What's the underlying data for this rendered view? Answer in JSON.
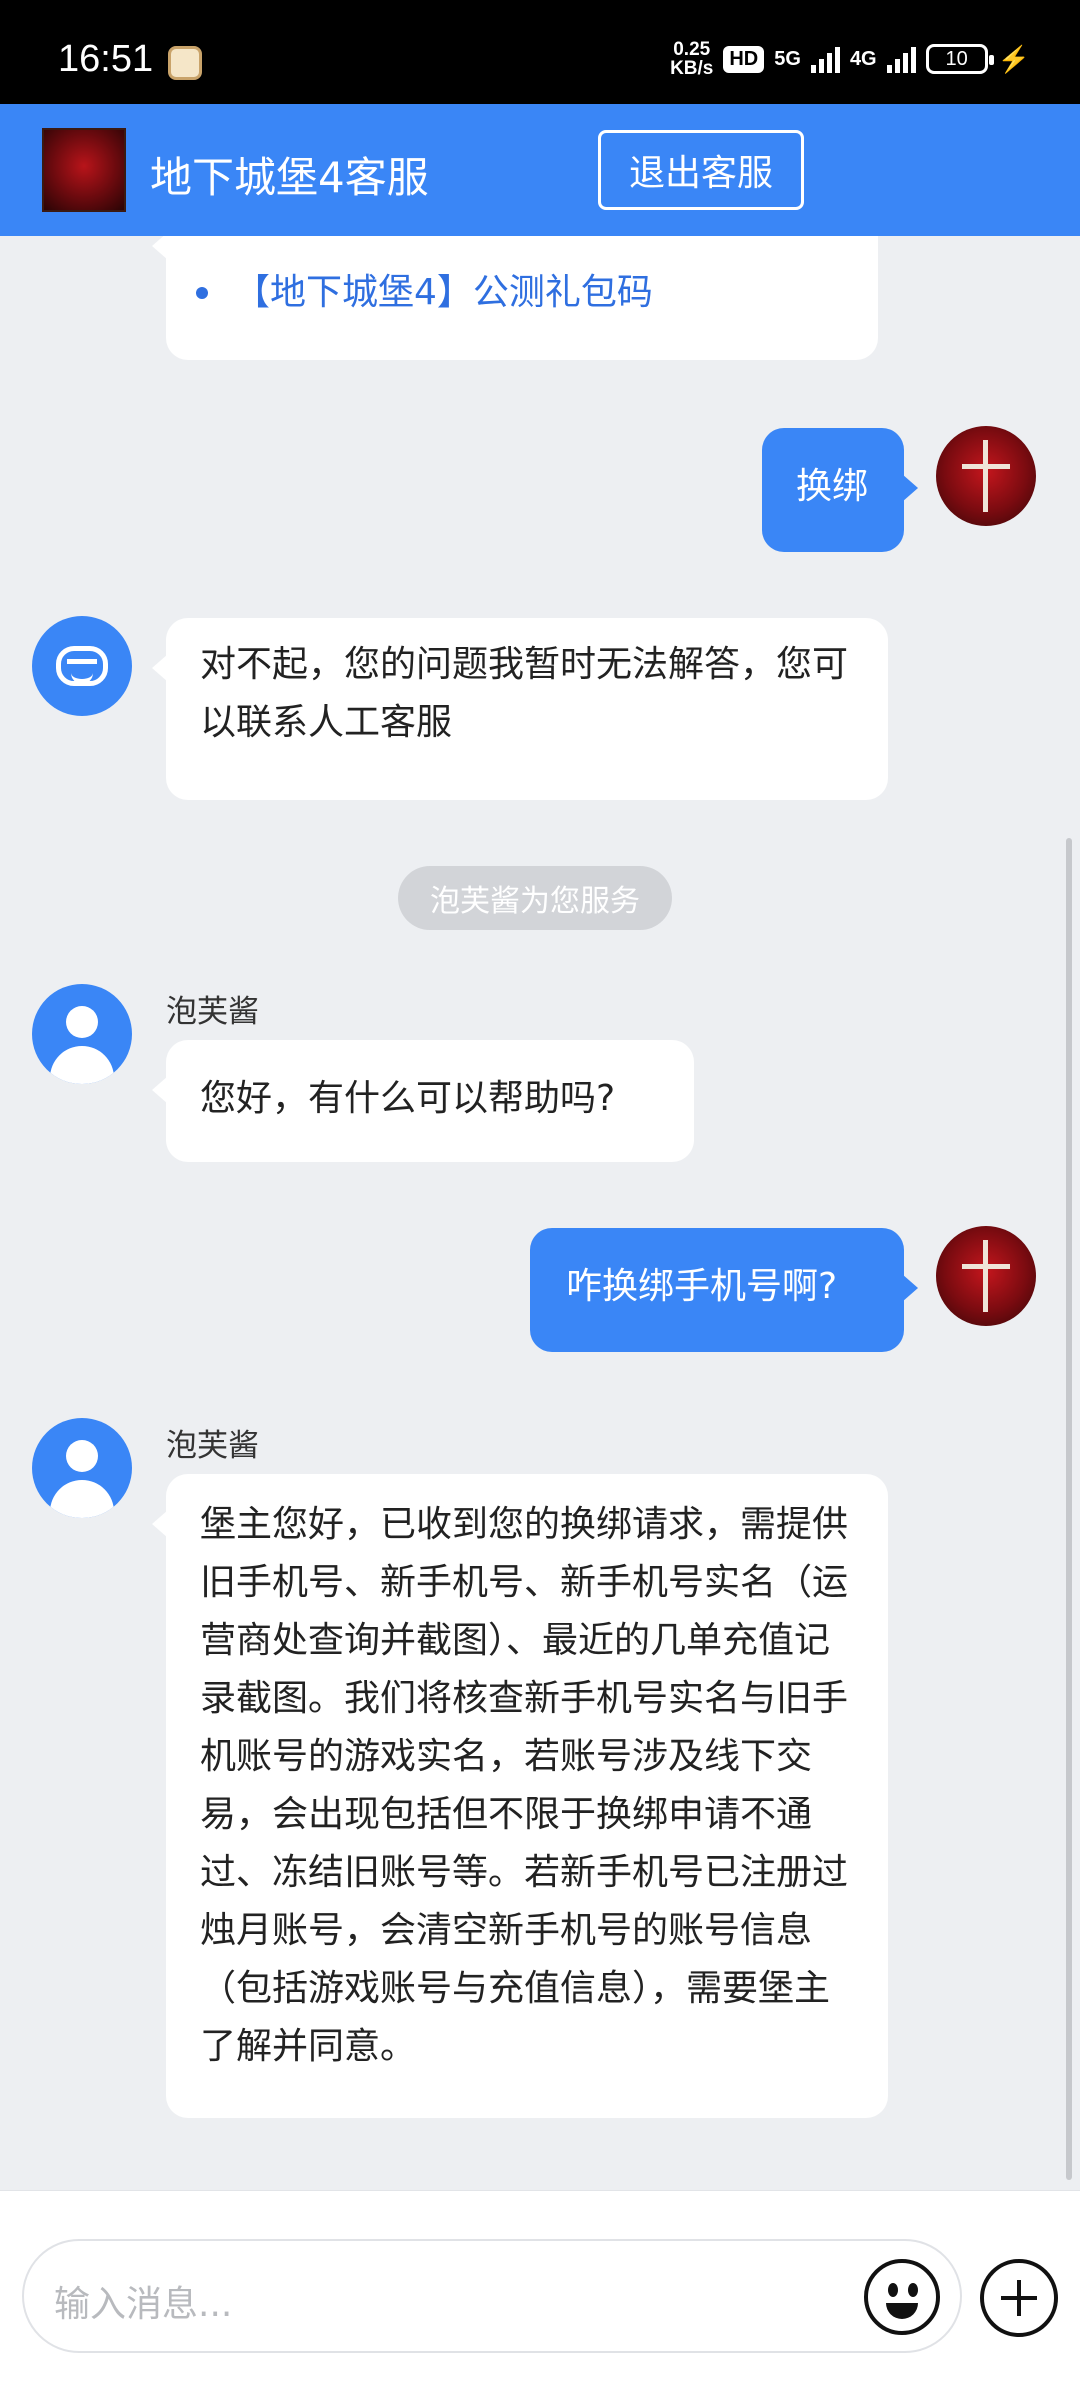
{
  "status_bar": {
    "time": "16:51",
    "speed_value": "0.25",
    "speed_unit": "KB/s",
    "hd": "HD",
    "net_5g": "5G",
    "net_4g": "4G",
    "battery": "10"
  },
  "header": {
    "title": "地下城堡4客服",
    "exit_label": "退出客服"
  },
  "chat": {
    "link_item": "【地下城堡4】公测礼包码",
    "msg_user_1": "换绑",
    "msg_bot_1": "对不起，您的问题我暂时无法解答，您可以联系人工客服",
    "system_notice": "泡芙酱为您服务",
    "agent_name": "泡芙酱",
    "msg_agent_1": "您好，有什么可以帮助吗?",
    "msg_user_2": "咋换绑手机号啊?",
    "msg_agent_2": "堡主您好，已收到您的换绑请求，需提供旧手机号、新手机号、新手机号实名（运营商处查询并截图）、最近的几单充值记录截图。我们将核查新手机号实名与旧手机账号的游戏实名，若账号涉及线下交易，会出现包括但不限于换绑申请不通过、冻结旧账号等。若新手机号已注册过烛月账号，会清空新手机号的账号信息（包括游戏账号与充值信息），需要堡主了解并同意。"
  },
  "input": {
    "placeholder": "输入消息..."
  },
  "icons": {
    "emoji": "emoji-icon",
    "plus": "plus-icon",
    "accent": "#3a86f6"
  }
}
